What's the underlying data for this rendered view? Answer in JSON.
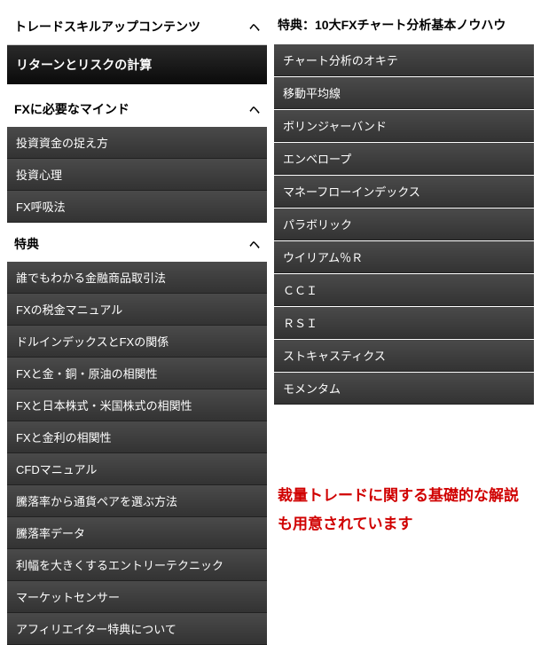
{
  "left": {
    "section1": {
      "title": "トレードスキルアップコンテンツ",
      "banner": "リターンとリスクの計算"
    },
    "section2": {
      "title": "FXに必要なマインド",
      "items": [
        "投資資金の捉え方",
        "投資心理",
        "FX呼吸法"
      ]
    },
    "section3": {
      "title": "特典",
      "items": [
        "誰でもわかる金融商品取引法",
        "FXの税金マニュアル",
        "ドルインデックスとFXの関係",
        "FXと金・銅・原油の相関性",
        "FXと日本株式・米国株式の相関性",
        "FXと金利の相関性",
        "CFDマニュアル",
        "騰落率から通貨ペアを選ぶ方法",
        "騰落率データ",
        "利幅を大きくするエントリーテクニック",
        "マーケットセンサー",
        "アフィリエイター特典について"
      ]
    }
  },
  "right": {
    "title": "特典：10大FXチャート分析基本ノウハウ",
    "items": [
      "チャート分析のオキテ",
      "移動平均線",
      "ボリンジャーバンド",
      "エンベロープ",
      "マネーフローインデックス",
      "パラボリック",
      "ウイリアム％Ｒ",
      "ＣＣＩ",
      "ＲＳＩ",
      "ストキャスティクス",
      "モメンタム"
    ],
    "note": "裁量トレードに関する基礎的な解説も用意されています"
  },
  "icons": {
    "chevron_up": "ヘ"
  }
}
